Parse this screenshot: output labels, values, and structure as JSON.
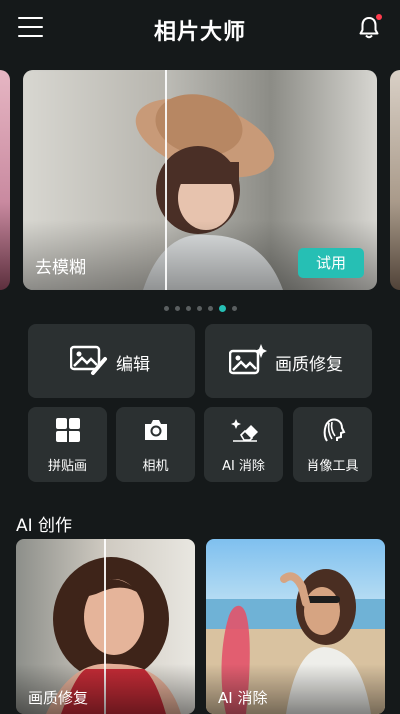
{
  "header": {
    "title": "相片大师"
  },
  "banner": {
    "label": "去模糊",
    "try_button": "试用",
    "page_count": 7,
    "active_page": 5
  },
  "main_tools": [
    {
      "id": "edit",
      "label": "编辑",
      "icon": "image-edit-icon"
    },
    {
      "id": "quality",
      "label": "画质修复",
      "icon": "image-sparkle-icon"
    }
  ],
  "small_tools": [
    {
      "id": "collage",
      "label": "拼贴画",
      "icon": "collage-grid-icon"
    },
    {
      "id": "camera",
      "label": "相机",
      "icon": "camera-icon"
    },
    {
      "id": "ai_erase",
      "label": "AI 消除",
      "icon": "eraser-sparkle-icon"
    },
    {
      "id": "portrait",
      "label": "肖像工具",
      "icon": "portrait-icon"
    }
  ],
  "ai_section": {
    "title": "AI 创作",
    "cards": [
      {
        "label": "画质修复"
      },
      {
        "label": "AI 消除"
      }
    ]
  },
  "colors": {
    "background": "#15191a",
    "card": "#2b3031",
    "accent": "#26bfb4",
    "notification_dot": "#ff3b4d"
  }
}
